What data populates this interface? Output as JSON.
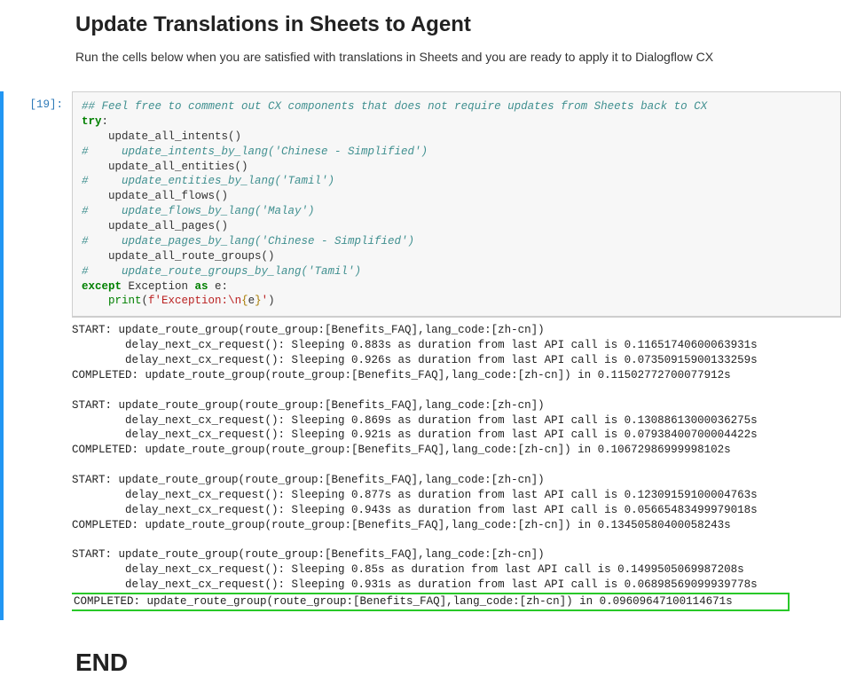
{
  "heading": {
    "title": "Update Translations in Sheets to Agent",
    "desc": "Run the cells below when you are satisfied with translations in Sheets and you are ready to apply it to Dialogflow CX"
  },
  "cell": {
    "prompt": "[19]:",
    "code": {
      "l1": "## Feel free to comment out CX components that does not require updates from Sheets back to CX",
      "l2a": "try",
      "l2b": ":",
      "l3": "    update_all_intents()",
      "l4": "#     update_intents_by_lang('Chinese - Simplified')",
      "l5": "    update_all_entities()",
      "l6": "#     update_entities_by_lang('Tamil')",
      "l7": "    update_all_flows()",
      "l8": "#     update_flows_by_lang('Malay')",
      "l9": "    update_all_pages()",
      "l10": "#     update_pages_by_lang('Chinese - Simplified')",
      "l11": "    update_all_route_groups()",
      "l12": "#     update_route_groups_by_lang('Tamil')",
      "l13a": "except",
      "l13b": " Exception ",
      "l13c": "as",
      "l13d": " e:",
      "l14a": "    ",
      "l14b": "print",
      "l14c": "(",
      "l14d": "f'Exception:",
      "l14e": "\\n",
      "l14f": "{",
      "l14g": "e",
      "l14h": "}",
      "l14i": "'",
      "l14j": ")"
    }
  },
  "output": {
    "line1": "START: update_route_group(route_group:[Benefits_FAQ],lang_code:[zh-cn])",
    "line2": "        delay_next_cx_request(): Sleeping 0.883s as duration from last API call is 0.11651740600063931s",
    "line3": "        delay_next_cx_request(): Sleeping 0.926s as duration from last API call is 0.07350915900133259s",
    "line4": "COMPLETED: update_route_group(route_group:[Benefits_FAQ],lang_code:[zh-cn]) in 0.11502772700077912s",
    "line5": "",
    "line6": "START: update_route_group(route_group:[Benefits_FAQ],lang_code:[zh-cn])",
    "line7": "        delay_next_cx_request(): Sleeping 0.869s as duration from last API call is 0.13088613000036275s",
    "line8": "        delay_next_cx_request(): Sleeping 0.921s as duration from last API call is 0.07938400700004422s",
    "line9": "COMPLETED: update_route_group(route_group:[Benefits_FAQ],lang_code:[zh-cn]) in 0.10672986999998102s",
    "line10": "",
    "line11": "START: update_route_group(route_group:[Benefits_FAQ],lang_code:[zh-cn])",
    "line12": "        delay_next_cx_request(): Sleeping 0.877s as duration from last API call is 0.12309159100004763s",
    "line13": "        delay_next_cx_request(): Sleeping 0.943s as duration from last API call is 0.05665483499979018s",
    "line14": "COMPLETED: update_route_group(route_group:[Benefits_FAQ],lang_code:[zh-cn]) in 0.13450580400058243s",
    "line15": "",
    "line16": "START: update_route_group(route_group:[Benefits_FAQ],lang_code:[zh-cn])",
    "line17": "        delay_next_cx_request(): Sleeping 0.85s as duration from last API call is 0.1499505069987208s",
    "line18": "        delay_next_cx_request(): Sleeping 0.931s as duration from last API call is 0.06898569099939778s",
    "line19": "COMPLETED: update_route_group(route_group:[Benefits_FAQ],lang_code:[zh-cn]) in 0.09609647100114671s        "
  },
  "end": {
    "title": "END"
  }
}
